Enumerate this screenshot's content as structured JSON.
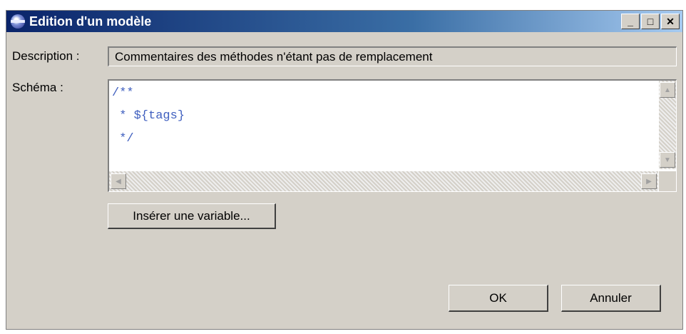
{
  "window": {
    "title": "Edition d'un modèle",
    "minimize_symbol": "_",
    "maximize_symbol": "□",
    "close_symbol": "✕"
  },
  "form": {
    "description_label": "Description :",
    "description_value": "Commentaires des méthodes n'étant pas de remplacement",
    "schema_label": "Schéma :",
    "schema_lines": [
      "/**",
      " * ${tags}",
      " */"
    ],
    "insert_variable_label": "Insérer une variable..."
  },
  "footer": {
    "ok_label": "OK",
    "cancel_label": "Annuler"
  },
  "colors": {
    "titlebar_start": "#0a246a",
    "titlebar_end": "#a6caf0",
    "dialog_bg": "#d4d0c8",
    "code_text": "#3f5fbf"
  }
}
